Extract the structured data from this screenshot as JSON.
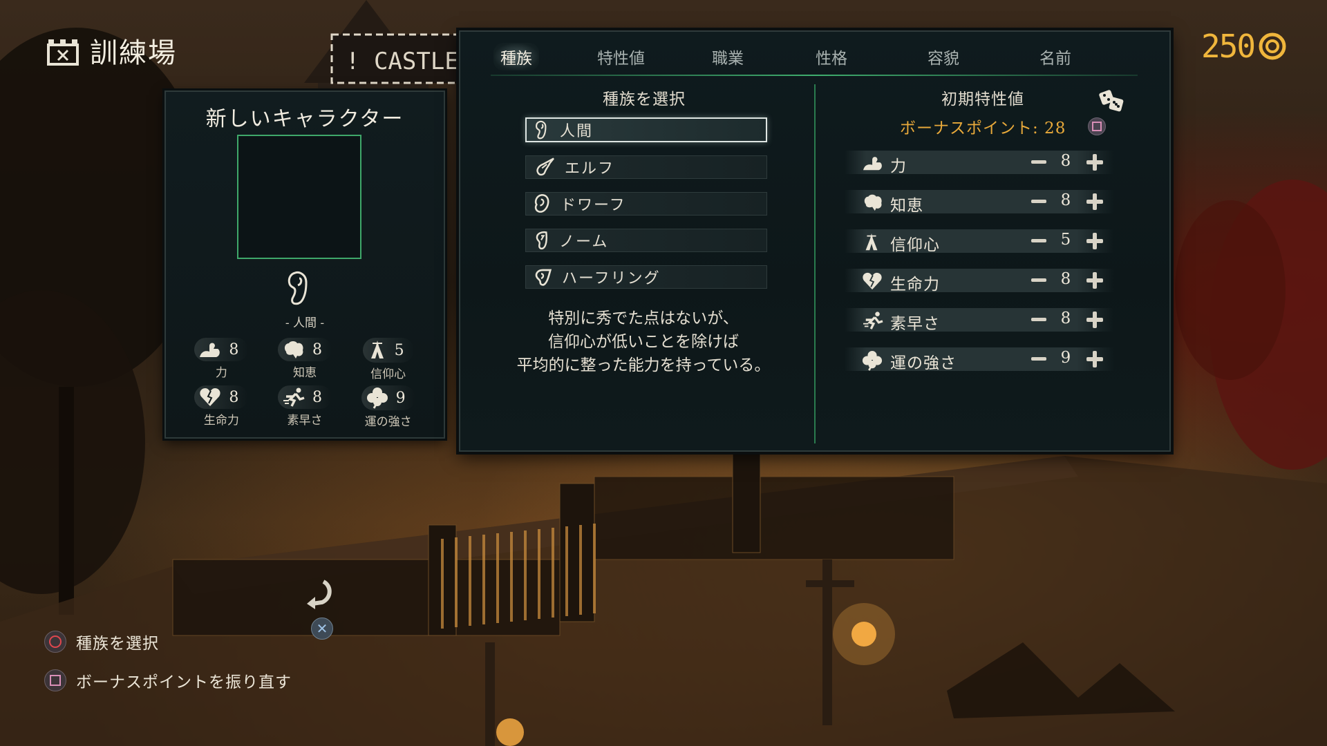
{
  "header": {
    "title": "訓練場",
    "icon": "castle-icon"
  },
  "currency": {
    "amount": "250",
    "icon": "gold-coin-icon"
  },
  "scene": {
    "sign_text": "! CASTLE"
  },
  "character_card": {
    "title": "新しいキャラクター",
    "race_label": "- 人間 -",
    "stats": [
      {
        "label": "力",
        "value": "8",
        "icon": "strength-arm-icon"
      },
      {
        "label": "知恵",
        "value": "8",
        "icon": "brain-icon"
      },
      {
        "label": "信仰心",
        "value": "5",
        "icon": "faith-icon"
      },
      {
        "label": "生命力",
        "value": "8",
        "icon": "heart-icon"
      },
      {
        "label": "素早さ",
        "value": "8",
        "icon": "agility-icon"
      },
      {
        "label": "運の強さ",
        "value": "9",
        "icon": "clover-icon"
      }
    ]
  },
  "tabs": [
    "種族",
    "特性値",
    "職業",
    "性格",
    "容貌",
    "名前"
  ],
  "active_tab": "種族",
  "race_panel": {
    "title": "種族を選択",
    "races": [
      "人間",
      "エルフ",
      "ドワーフ",
      "ノーム",
      "ハーフリング"
    ],
    "selected": "人間",
    "description": [
      "特別に秀でた点はないが、",
      "信仰心が低いことを除けば",
      "平均的に整った能力を持っている。"
    ]
  },
  "attributes_panel": {
    "title": "初期特性値",
    "bonus_label": "ボーナスポイント: 28",
    "rows": [
      {
        "name": "力",
        "value": "8",
        "icon": "strength-arm-icon"
      },
      {
        "name": "知恵",
        "value": "8",
        "icon": "brain-icon"
      },
      {
        "name": "信仰心",
        "value": "5",
        "icon": "faith-icon"
      },
      {
        "name": "生命力",
        "value": "8",
        "icon": "heart-icon"
      },
      {
        "name": "素早さ",
        "value": "8",
        "icon": "agility-icon"
      },
      {
        "name": "運の強さ",
        "value": "9",
        "icon": "clover-icon"
      }
    ]
  },
  "prompts": [
    {
      "button": "circle",
      "label": "種族を選択"
    },
    {
      "button": "square",
      "label": "ボーナスポイントを振り直す"
    }
  ],
  "colors": {
    "accent_green": "#3fae6e",
    "gold": "#f0b63c",
    "bonus_orange": "#e8a93a"
  }
}
